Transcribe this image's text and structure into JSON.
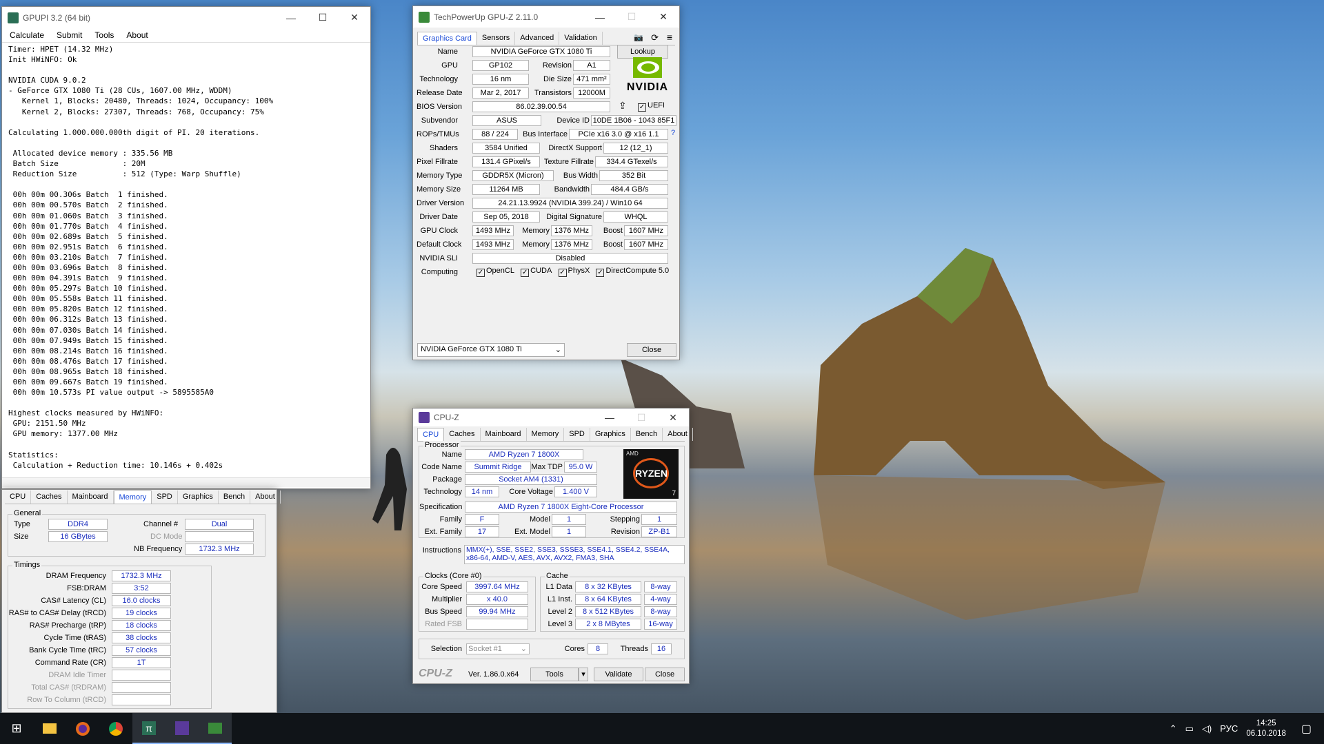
{
  "gpupi": {
    "title": "GPUPI 3.2 (64 bit)",
    "menu": [
      "Calculate",
      "Submit",
      "Tools",
      "About"
    ],
    "output": "Timer: HPET (14.32 MHz)\nInit HWiNFO: Ok\n\nNVIDIA CUDA 9.0.2\n- GeForce GTX 1080 Ti (28 CUs, 1607.00 MHz, WDDM)\n   Kernel 1, Blocks: 20480, Threads: 1024, Occupancy: 100%\n   Kernel 2, Blocks: 27307, Threads: 768, Occupancy: 75%\n\nCalculating 1.000.000.000th digit of PI. 20 iterations.\n\n Allocated device memory : 335.56 MB\n Batch Size              : 20M\n Reduction Size          : 512 (Type: Warp Shuffle)\n\n 00h 00m 00.306s Batch  1 finished.\n 00h 00m 00.570s Batch  2 finished.\n 00h 00m 01.060s Batch  3 finished.\n 00h 00m 01.770s Batch  4 finished.\n 00h 00m 02.689s Batch  5 finished.\n 00h 00m 02.951s Batch  6 finished.\n 00h 00m 03.210s Batch  7 finished.\n 00h 00m 03.696s Batch  8 finished.\n 00h 00m 04.391s Batch  9 finished.\n 00h 00m 05.297s Batch 10 finished.\n 00h 00m 05.558s Batch 11 finished.\n 00h 00m 05.820s Batch 12 finished.\n 00h 00m 06.312s Batch 13 finished.\n 00h 00m 07.030s Batch 14 finished.\n 00h 00m 07.949s Batch 15 finished.\n 00h 00m 08.214s Batch 16 finished.\n 00h 00m 08.476s Batch 17 finished.\n 00h 00m 08.965s Batch 18 finished.\n 00h 00m 09.667s Batch 19 finished.\n 00h 00m 10.573s PI value output -> 5895585A0\n\nHighest clocks measured by HWiNFO:\n GPU: 2151.50 MHz\n GPU memory: 1377.00 MHz\n\nStatistics:\n Calculation + Reduction time: 10.146s + 0.402s"
  },
  "cpuz_mem": {
    "tabs": [
      "CPU",
      "Caches",
      "Mainboard",
      "Memory",
      "SPD",
      "Graphics",
      "Bench",
      "About"
    ],
    "general": "General",
    "type_l": "Type",
    "type": "DDR4",
    "channel_l": "Channel #",
    "channel": "Dual",
    "size_l": "Size",
    "size": "16 GBytes",
    "dcmode_l": "DC Mode",
    "nbfreq_l": "NB Frequency",
    "nbfreq": "1732.3 MHz",
    "timings": "Timings",
    "rows": [
      {
        "l": "DRAM Frequency",
        "v": "1732.3 MHz"
      },
      {
        "l": "FSB:DRAM",
        "v": "3:52"
      },
      {
        "l": "CAS# Latency (CL)",
        "v": "16.0 clocks"
      },
      {
        "l": "RAS# to CAS# Delay (tRCD)",
        "v": "19 clocks"
      },
      {
        "l": "RAS# Precharge (tRP)",
        "v": "18 clocks"
      },
      {
        "l": "Cycle Time (tRAS)",
        "v": "38 clocks"
      },
      {
        "l": "Bank Cycle Time (tRC)",
        "v": "57 clocks"
      },
      {
        "l": "Command Rate (CR)",
        "v": "1T"
      },
      {
        "l": "DRAM Idle Timer",
        "v": ""
      },
      {
        "l": "Total CAS# (tRDRAM)",
        "v": ""
      },
      {
        "l": "Row To Column (tRCD)",
        "v": ""
      }
    ]
  },
  "gpuz": {
    "title": "TechPowerUp GPU-Z 2.11.0",
    "tabs": [
      "Graphics Card",
      "Sensors",
      "Advanced",
      "Validation"
    ],
    "name_l": "Name",
    "name": "NVIDIA GeForce GTX 1080 Ti",
    "lookup": "Lookup",
    "gpu_l": "GPU",
    "gpu": "GP102",
    "rev_l": "Revision",
    "rev": "A1",
    "tech_l": "Technology",
    "tech": "16 nm",
    "die_l": "Die Size",
    "die": "471 mm²",
    "rel_l": "Release Date",
    "rel": "Mar 2, 2017",
    "tr_l": "Transistors",
    "tr": "12000M",
    "bios_l": "BIOS Version",
    "bios": "86.02.39.00.54",
    "uefi": "UEFI",
    "sub_l": "Subvendor",
    "sub": "ASUS",
    "dev_l": "Device ID",
    "dev": "10DE 1B06 - 1043 85F1",
    "rops_l": "ROPs/TMUs",
    "rops": "88 / 224",
    "bus_l": "Bus Interface",
    "bus": "PCIe x16 3.0 @ x16 1.1",
    "q": "?",
    "sh_l": "Shaders",
    "sh": "3584 Unified",
    "dx_l": "DirectX Support",
    "dx": "12 (12_1)",
    "pf_l": "Pixel Fillrate",
    "pf": "131.4 GPixel/s",
    "tf_l": "Texture Fillrate",
    "tf": "334.4 GTexel/s",
    "mt_l": "Memory Type",
    "mt": "GDDR5X (Micron)",
    "bw_l": "Bus Width",
    "bw": "352 Bit",
    "ms_l": "Memory Size",
    "ms": "11264 MB",
    "band_l": "Bandwidth",
    "band": "484.4 GB/s",
    "dv_l": "Driver Version",
    "dv": "24.21.13.9924 (NVIDIA 399.24) / Win10 64",
    "dd_l": "Driver Date",
    "dd": "Sep 05, 2018",
    "ds_l": "Digital Signature",
    "ds": "WHQL",
    "gc_l": "GPU Clock",
    "gc": "1493 MHz",
    "mem_l": "Memory",
    "gcm": "1376 MHz",
    "boost_l": "Boost",
    "gcb": "1607 MHz",
    "dc_l": "Default Clock",
    "dc": "1493 MHz",
    "dcm": "1376 MHz",
    "dcb": "1607 MHz",
    "sli_l": "NVIDIA SLI",
    "sli": "Disabled",
    "comp_l": "Computing",
    "comp": [
      "OpenCL",
      "CUDA",
      "PhysX",
      "DirectCompute 5.0"
    ],
    "select": "NVIDIA GeForce GTX 1080 Ti",
    "close": "Close",
    "logo": "NVIDIA"
  },
  "cpuz": {
    "title": "CPU-Z",
    "tabs": [
      "CPU",
      "Caches",
      "Mainboard",
      "Memory",
      "SPD",
      "Graphics",
      "Bench",
      "About"
    ],
    "processor": "Processor",
    "name_l": "Name",
    "name": "AMD Ryzen 7 1800X",
    "code_l": "Code Name",
    "code": "Summit Ridge",
    "tdp_l": "Max TDP",
    "tdp": "95.0 W",
    "pkg_l": "Package",
    "pkg": "Socket AM4 (1331)",
    "tech_l": "Technology",
    "tech": "14 nm",
    "cv_l": "Core Voltage",
    "cv": "1.400 V",
    "spec_l": "Specification",
    "spec": "AMD Ryzen 7 1800X Eight-Core Processor",
    "fam_l": "Family",
    "fam": "F",
    "mod_l": "Model",
    "mod": "1",
    "step_l": "Stepping",
    "step": "1",
    "efam_l": "Ext. Family",
    "efam": "17",
    "emod_l": "Ext. Model",
    "emod": "1",
    "rev_l": "Revision",
    "rev": "ZP-B1",
    "ins_l": "Instructions",
    "ins": "MMX(+), SSE, SSE2, SSE3, SSSE3, SSE4.1, SSE4.2, SSE4A, x86-64, AMD-V, AES, AVX, AVX2, FMA3, SHA",
    "clocks": "Clocks (Core #0)",
    "cs_l": "Core Speed",
    "cs": "3997.64 MHz",
    "mul_l": "Multiplier",
    "mul": "x 40.0",
    "bs_l": "Bus Speed",
    "bs": "99.94 MHz",
    "rf_l": "Rated FSB",
    "cache": "Cache",
    "l1d_l": "L1 Data",
    "l1d": "8 x 32 KBytes",
    "l1d_w": "8-way",
    "l1i_l": "L1 Inst.",
    "l1i": "8 x 64 KBytes",
    "l1i_w": "4-way",
    "l2_l": "Level 2",
    "l2": "8 x 512 KBytes",
    "l2_w": "8-way",
    "l3_l": "Level 3",
    "l3": "2 x 8 MBytes",
    "l3_w": "16-way",
    "sel_l": "Selection",
    "sel": "Socket #1",
    "cores_l": "Cores",
    "cores": "8",
    "thr_l": "Threads",
    "thr": "16",
    "brand": "CPU-Z",
    "ver": "Ver. 1.86.0.x64",
    "tools": "Tools",
    "validate": "Validate",
    "close": "Close",
    "logo_top": "AMD",
    "logo": "RYZEN",
    "logo_n": "7"
  },
  "taskbar": {
    "lang": "РУС",
    "time": "14:25",
    "date": "06.10.2018"
  }
}
